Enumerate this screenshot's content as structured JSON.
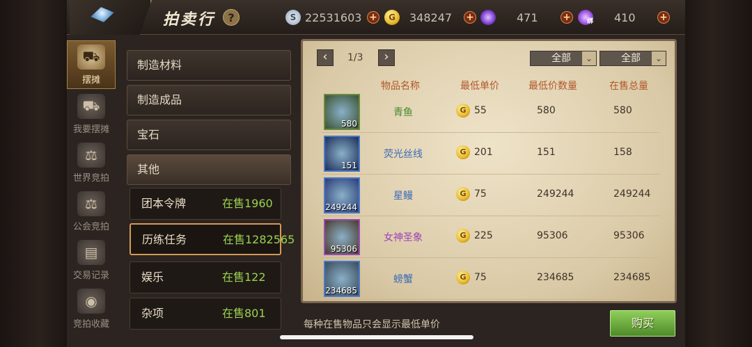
{
  "header": {
    "title": "拍卖行",
    "help_label": "?",
    "currencies": [
      {
        "icon": "silver-coin-icon",
        "value": "22531603",
        "color": "#b8c6d8"
      },
      {
        "icon": "gold-coin-icon",
        "value": "348247",
        "color": "#e8b82a"
      },
      {
        "icon": "purple-gem-icon",
        "value": "471",
        "color": "#8a4fd8"
      },
      {
        "icon": "bound-purple-gem-icon",
        "value": "410",
        "color": "#a35ae0",
        "badge": "绑"
      }
    ],
    "plus_label": "+"
  },
  "sidenav": [
    {
      "label": "摆摊",
      "active": true
    },
    {
      "label": "我要摆摊",
      "active": false
    },
    {
      "label": "世界竞拍",
      "active": false
    },
    {
      "label": "公会竞拍",
      "active": false
    },
    {
      "label": "交易记录",
      "active": false
    },
    {
      "label": "竞拍收藏",
      "active": false
    }
  ],
  "categories": [
    "制造材料",
    "制造成品",
    "宝石",
    "其他"
  ],
  "subcategories": [
    {
      "name": "团本令牌",
      "count": "在售1960"
    },
    {
      "name": "历练任务",
      "count": "在售1282565"
    },
    {
      "name": "娱乐",
      "count": "在售122"
    },
    {
      "name": "杂项",
      "count": "在售801"
    }
  ],
  "pager": {
    "prev": "‹",
    "next": "›",
    "text": "1/3"
  },
  "filters": [
    {
      "label": "全部"
    },
    {
      "label": "全部"
    }
  ],
  "columns": {
    "name": "物品名称",
    "min_price": "最低单价",
    "min_qty": "最低价数量",
    "total": "在售总量"
  },
  "items": [
    {
      "name": "青鱼",
      "qty": "580",
      "price": "55",
      "min_qty": "580",
      "total": "580",
      "name_color": "#3f8a2a",
      "frame": "#6a8a40",
      "bg": "#3a5230"
    },
    {
      "name": "荧光丝线",
      "qty": "151",
      "price": "201",
      "min_qty": "151",
      "total": "158",
      "name_color": "#3a6ab8",
      "frame": "#4a78c8",
      "bg": "#1c2e5a"
    },
    {
      "name": "星鳗",
      "qty": "249244",
      "price": "75",
      "min_qty": "249244",
      "total": "249244",
      "name_color": "#3a6ab8",
      "frame": "#4a78c8",
      "bg": "#2a3c78"
    },
    {
      "name": "女神圣象",
      "qty": "95306",
      "price": "225",
      "min_qty": "95306",
      "total": "95306",
      "name_color": "#a040b8",
      "frame": "#9a4ab8",
      "bg": "#4a3a2a"
    },
    {
      "name": "螃蟹",
      "qty": "234685",
      "price": "75",
      "min_qty": "234685",
      "total": "234685",
      "name_color": "#3a6ab8",
      "frame": "#4a78c8",
      "bg": "#3a4a5a"
    }
  ],
  "coin_glyph": "G",
  "footnote": "每种在售物品只会显示最低单价",
  "buy_label": "购买"
}
